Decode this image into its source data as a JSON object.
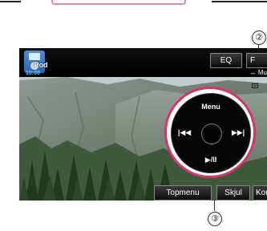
{
  "callouts": {
    "top": "②",
    "bottom": "③"
  },
  "status": {
    "ipod_label": "iPod",
    "clock": "10:00",
    "mode_text": "↔ Mu"
  },
  "toolbar": {
    "eq_label": "EQ",
    "f_label": "F"
  },
  "controller": {
    "menu_label": "Menu",
    "prev_label": "|◀◀",
    "next_label": "▶▶|",
    "play_pause_label": "▶/II"
  },
  "bottom_bar": {
    "topmenu_label": "Topmenu",
    "hide_label": "Skjul",
    "more_label": "Kor"
  },
  "colors": {
    "highlight": "#d8336b",
    "frame": "#e08aa6",
    "clock": "#66ccff"
  }
}
